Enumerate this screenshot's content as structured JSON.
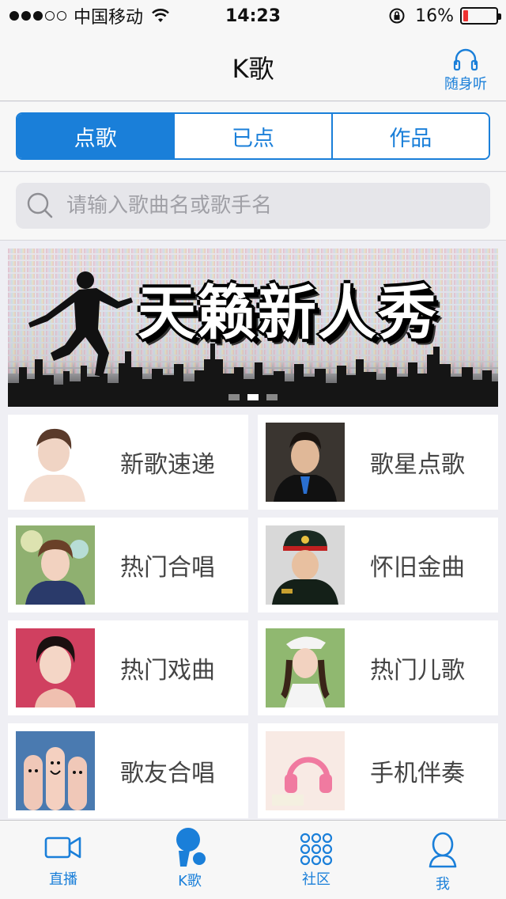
{
  "status_bar": {
    "signal_on": 3,
    "signal_total": 5,
    "carrier": "中国移动",
    "time": "14:23",
    "battery": "16%",
    "battery_level": 0.16
  },
  "nav": {
    "title": "K歌",
    "listen_label": "随身听"
  },
  "segments": [
    {
      "label": "点歌",
      "active": true
    },
    {
      "label": "已点",
      "active": false
    },
    {
      "label": "作品",
      "active": false
    }
  ],
  "search": {
    "placeholder": "请输入歌曲名或歌手名"
  },
  "banner": {
    "title": "天籁新人秀",
    "page_count": 3,
    "current_page": 2
  },
  "grid": [
    {
      "label": "新歌速递"
    },
    {
      "label": "歌星点歌"
    },
    {
      "label": "热门合唱"
    },
    {
      "label": "怀旧金曲"
    },
    {
      "label": "热门戏曲"
    },
    {
      "label": "热门儿歌"
    },
    {
      "label": "歌友合唱"
    },
    {
      "label": "手机伴奏"
    }
  ],
  "tabs": [
    {
      "label": "直播",
      "icon": "video-icon"
    },
    {
      "label": "K歌",
      "icon": "microphone-icon"
    },
    {
      "label": "社区",
      "icon": "grid-dots-icon"
    },
    {
      "label": "我",
      "icon": "person-icon"
    }
  ],
  "colors": {
    "accent": "#1a7fd9",
    "battery_low": "#e33333"
  }
}
